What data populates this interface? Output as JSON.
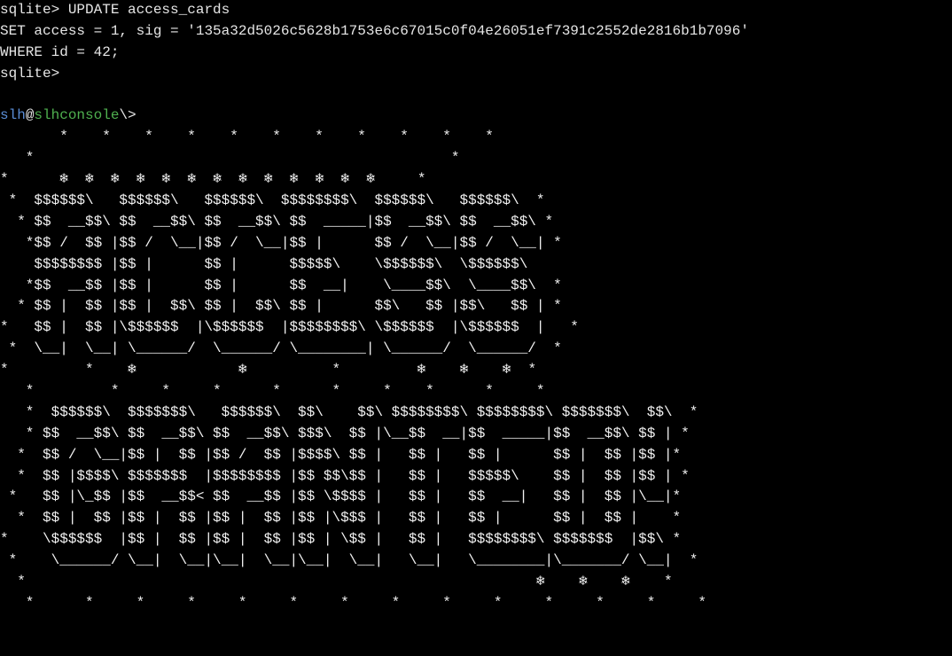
{
  "terminal": {
    "sql_lines": [
      "sqlite> UPDATE access_cards",
      "SET access = 1, sig = '135a32d5026c5628b1753e6c67015c0f04e26051ef7391c2552de2816b1b7096'",
      "WHERE id = 42;",
      "sqlite>"
    ],
    "blank_line": "",
    "prompt": {
      "user": "slh",
      "at": "@",
      "host": "slhconsole",
      "path": "\\>"
    },
    "art_lines": [
      "       *    *    *    *    *    *    *    *    *    *    *",
      "   *                                                 *",
      "*      ❄  ❄  ❄  ❄  ❄  ❄  ❄  ❄  ❄  ❄  ❄  ❄  ❄     *",
      " *  $$$$$$\\   $$$$$$\\   $$$$$$\\  $$$$$$$$\\  $$$$$$\\   $$$$$$\\  *",
      "  * $$  __$$\\ $$  __$$\\ $$  __$$\\ $$  _____|$$  __$$\\ $$  __$$\\ *",
      "   *$$ /  $$ |$$ /  \\__|$$ /  \\__|$$ |      $$ /  \\__|$$ /  \\__| *",
      "    $$$$$$$$ |$$ |      $$ |      $$$$$\\    \\$$$$$$\\  \\$$$$$$\\",
      "   *$$  __$$ |$$ |      $$ |      $$  __|    \\____$$\\  \\____$$\\  *",
      "  * $$ |  $$ |$$ |  $$\\ $$ |  $$\\ $$ |      $$\\   $$ |$$\\   $$ | *",
      "*   $$ |  $$ |\\$$$$$$  |\\$$$$$$  |$$$$$$$$\\ \\$$$$$$  |\\$$$$$$  |   *",
      " *  \\__|  \\__| \\______/  \\______/ \\________| \\______/  \\______/  *",
      "*         *    ❄            ❄          *         ❄    ❄    ❄  *",
      "   *         *     *     *      *      *     *    *      *     *",
      "   *  $$$$$$\\  $$$$$$$\\   $$$$$$\\  $$\\    $$\\ $$$$$$$$\\ $$$$$$$$\\ $$$$$$$\\  $$\\  *",
      "   * $$  __$$\\ $$  __$$\\ $$  __$$\\ $$$\\  $$ |\\__$$  __|$$  _____|$$  __$$\\ $$ | *",
      "  *  $$ /  \\__|$$ |  $$ |$$ /  $$ |$$$$\\ $$ |   $$ |   $$ |      $$ |  $$ |$$ |*",
      "  *  $$ |$$$$\\ $$$$$$$  |$$$$$$$$ |$$ $$\\$$ |   $$ |   $$$$$\\    $$ |  $$ |$$ | *",
      " *   $$ |\\_$$ |$$  __$$< $$  __$$ |$$ \\$$$$ |   $$ |   $$  __|   $$ |  $$ |\\__|*",
      "  *  $$ |  $$ |$$ |  $$ |$$ |  $$ |$$ |\\$$$ |   $$ |   $$ |      $$ |  $$ |    *",
      "*    \\$$$$$$  |$$ |  $$ |$$ |  $$ |$$ | \\$$ |   $$ |   $$$$$$$$\\ $$$$$$$  |$$\\ *",
      " *    \\______/ \\__|  \\__|\\__|  \\__|\\__|  \\__|   \\__|   \\________|\\_______/ \\__|  *",
      "  *                                                            ❄    ❄    ❄    *",
      "   *      *     *     *     *     *     *     *     *     *     *     *     *     *"
    ]
  }
}
